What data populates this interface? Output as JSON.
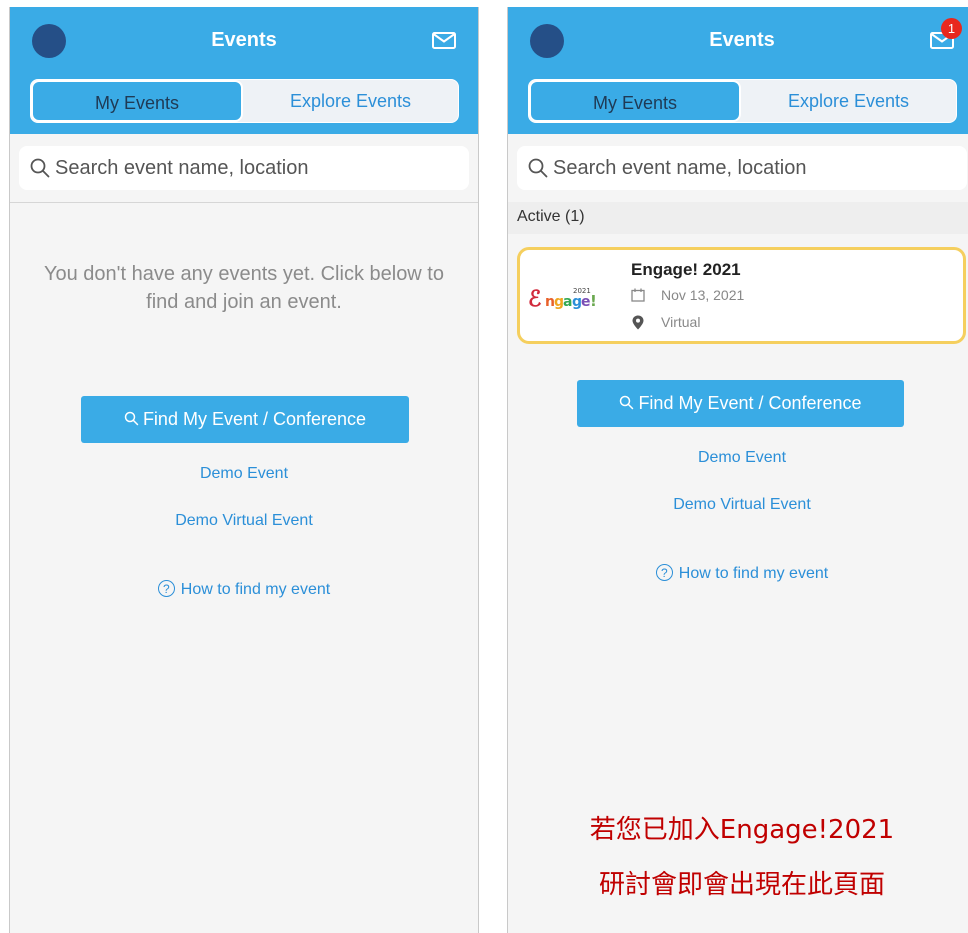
{
  "left_screen": {
    "header": {
      "title": "Events"
    },
    "tabs": [
      {
        "label": "My Events"
      },
      {
        "label": "Explore Events"
      }
    ],
    "search": {
      "placeholder": "Search event name, location"
    },
    "empty_message": "You don't have any events yet. Click below to find and join an event.",
    "find_button": "Find My Event / Conference",
    "links": [
      "Demo Event",
      "Demo Virtual Event"
    ],
    "help": {
      "icon_glyph": "?",
      "label": "How to find my event"
    }
  },
  "right_screen": {
    "header": {
      "title": "Events",
      "badge": "1"
    },
    "tabs": [
      {
        "label": "My Events"
      },
      {
        "label": "Explore Events"
      }
    ],
    "search": {
      "placeholder": "Search event name, location"
    },
    "section": "Active (1)",
    "event": {
      "logo_text": "Engage!",
      "logo_year": "2021",
      "name": "Engage! 2021",
      "date": "Nov 13, 2021",
      "location": "Virtual"
    },
    "find_button": "Find My Event / Conference",
    "links": [
      "Demo Event",
      "Demo Virtual Event"
    ],
    "help": {
      "icon_glyph": "?",
      "label": "How to find my event"
    },
    "annotation": [
      "若您已加入Engage!2021",
      "研討會即會出現在此頁面"
    ]
  },
  "colors": {
    "app_bar": "#3aabe6",
    "link": "#2b8fd8",
    "badge": "#e8281e",
    "highlight_border": "#f5cf5e",
    "annotation_text": "#c00000"
  }
}
